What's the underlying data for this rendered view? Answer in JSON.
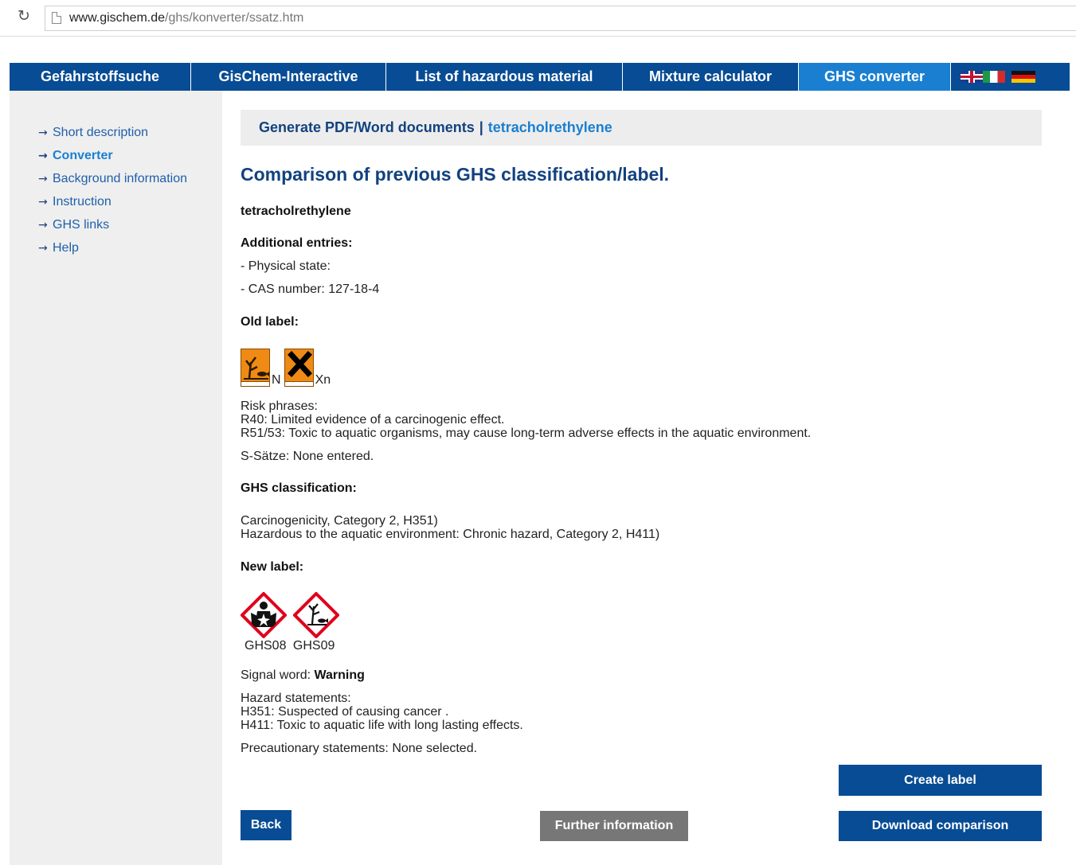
{
  "browser": {
    "url_host": "www.gischem.de",
    "url_path": "/ghs/konverter/ssatz.htm"
  },
  "nav": {
    "tabs": [
      {
        "label": "Gefahrstoffsuche"
      },
      {
        "label": "GisChem-Interactive"
      },
      {
        "label": "List of hazardous material"
      },
      {
        "label": "Mixture calculator"
      },
      {
        "label": "GHS converter"
      }
    ],
    "active_tab": "GHS converter"
  },
  "sidebar": {
    "items": [
      {
        "label": "Short description"
      },
      {
        "label": "Converter"
      },
      {
        "label": "Background information"
      },
      {
        "label": "Instruction"
      },
      {
        "label": "GHS links"
      },
      {
        "label": "Help"
      }
    ],
    "active_item": "Converter"
  },
  "header": {
    "section": "Generate PDF/Word documents",
    "separator": "|",
    "substance": "tetracholrethylene"
  },
  "page": {
    "title": "Comparison of previous GHS classification/label.",
    "substance": "tetracholrethylene",
    "additional_heading": "Additional entries:",
    "physical_state": "- Physical state:",
    "cas_number": "- CAS number: 127-18-4",
    "old_label_heading": "Old label:",
    "old_symbols": [
      {
        "code": "N",
        "icon": "dead-tree-fish-icon"
      },
      {
        "code": "Xn",
        "icon": "x-cross-icon"
      }
    ],
    "risk_heading": "Risk phrases:",
    "risk_phrases": [
      "R40: Limited evidence of a carcinogenic effect.",
      "R51/53: Toxic to aquatic organisms, may cause long-term adverse effects in the aquatic environment."
    ],
    "s_saetze": "S-Sätze: None entered.",
    "ghs_heading": "GHS classification:",
    "ghs_classification": [
      "Carcinogenicity, Category 2, H351)",
      "Hazardous to the aquatic environment: Chronic hazard, Category 2, H411)"
    ],
    "new_label_heading": "New label:",
    "ghs_symbols": [
      {
        "code": "GHS08",
        "icon": "health-hazard-icon"
      },
      {
        "code": "GHS09",
        "icon": "environment-icon"
      }
    ],
    "signal_word_label": "Signal word:",
    "signal_word": "Warning",
    "hazard_heading": "Hazard statements:",
    "hazard_statements": [
      "H351: Suspected of causing cancer .",
      "H411: Toxic to aquatic life with long lasting effects."
    ],
    "precautionary": "Precautionary statements: None selected."
  },
  "buttons": {
    "create_label": "Create label",
    "back": "Back",
    "further_info": "Further information",
    "download_comparison": "Download comparison"
  },
  "colors": {
    "nav_bg": "#074c94",
    "nav_active": "#1a7fd1",
    "title": "#12427f",
    "button": "#074c94",
    "button_gray": "#777777",
    "hazard_red": "#e0001b",
    "hazard_orange": "#ef8a14"
  }
}
